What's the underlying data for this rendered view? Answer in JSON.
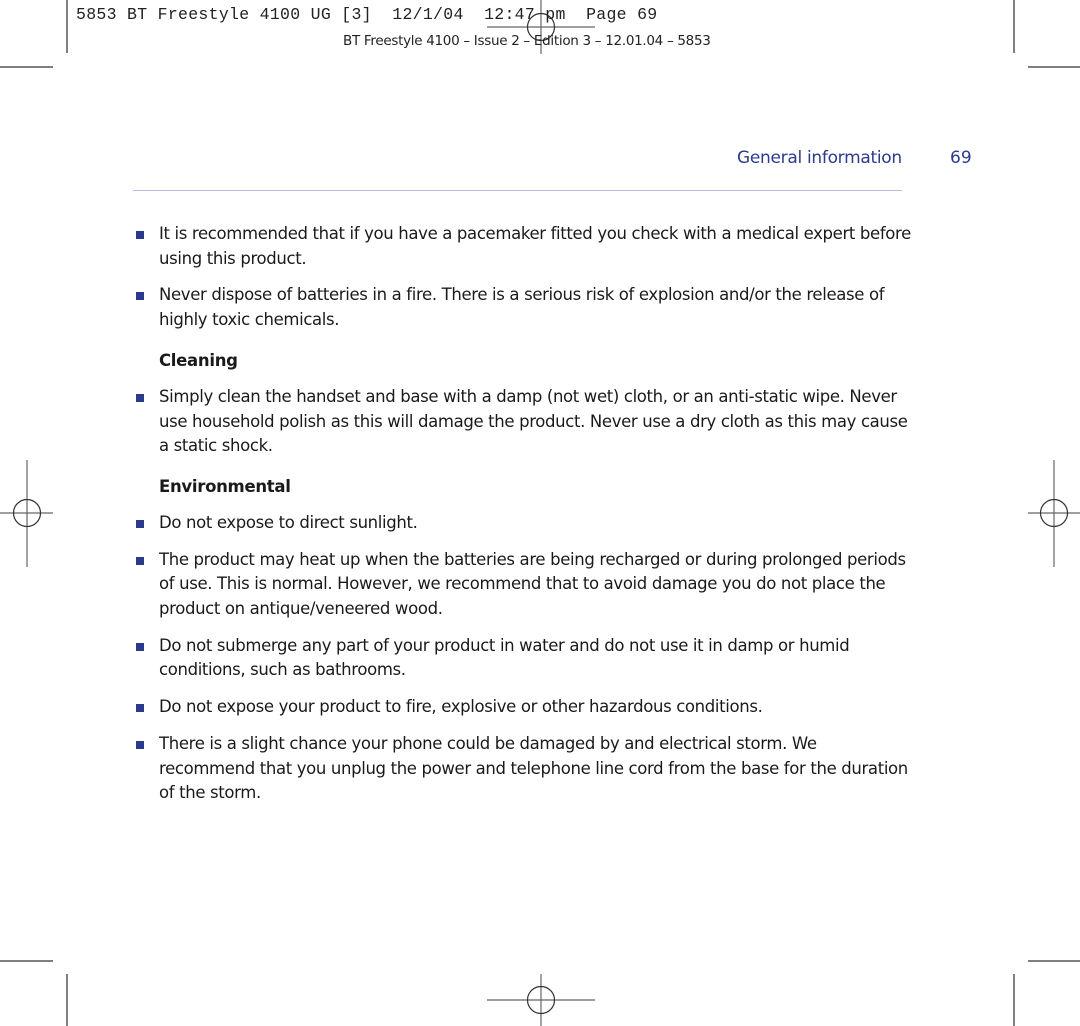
{
  "slug_line": "5853 BT Freestyle 4100 UG [3]  12/1/04  12:47 pm  Page 69",
  "issue_line": "BT Freestyle 4100 – Issue 2 – Edition 3 – 12.01.04 – 5853",
  "header": {
    "section_title": "General information",
    "page_number": "69"
  },
  "colors": {
    "accent": "#2c3a8c",
    "rule": "#b9b9dc",
    "text": "#1a1a1a"
  },
  "bullets_intro": [
    "It is recommended that if you have a pacemaker fitted you check with a medical expert before using this product.",
    "Never dispose of batteries in a fire. There is a serious risk of explosion and/or the release of highly toxic chemicals."
  ],
  "cleaning": {
    "heading": "Cleaning",
    "items": [
      "Simply clean the handset and base with a damp (not wet) cloth, or an anti-static wipe. Never use household polish as this will damage the product. Never use a dry cloth as this may cause a static shock."
    ]
  },
  "environmental": {
    "heading": "Environmental",
    "items": [
      "Do not expose to direct sunlight.",
      "The product may heat up when the batteries are being recharged or during prolonged periods of use. This is normal. However, we recommend that to avoid damage you do not place the product on antique/veneered wood.",
      "Do not submerge any part of your product in water and do not use it in damp or humid conditions, such as bathrooms.",
      "Do not expose your product to fire, explosive or other hazardous conditions.",
      "There is a slight chance your phone could be damaged by and electrical storm. We recommend that you unplug the power and telephone line cord from the base for the duration of the storm."
    ]
  }
}
